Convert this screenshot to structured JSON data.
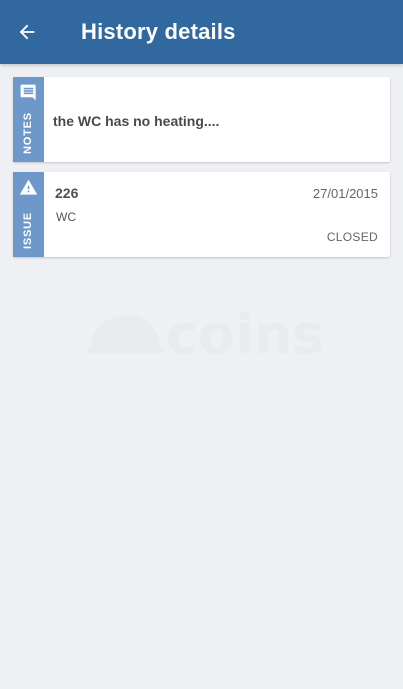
{
  "header": {
    "title": "History details",
    "back_icon": "arrow-left-icon",
    "background_color": "#3168a0"
  },
  "watermark": {
    "text": "coins"
  },
  "notes_card": {
    "label": "NOTES",
    "icon": "comment-icon",
    "text": "the WC has no heating...."
  },
  "issue_card": {
    "label": "ISSUE",
    "icon": "warning-icon",
    "number": "226",
    "date": "27/01/2015",
    "location": "WC",
    "status": "CLOSED"
  },
  "colors": {
    "strip": "#6d98c9",
    "page_background": "#eef0f3"
  }
}
